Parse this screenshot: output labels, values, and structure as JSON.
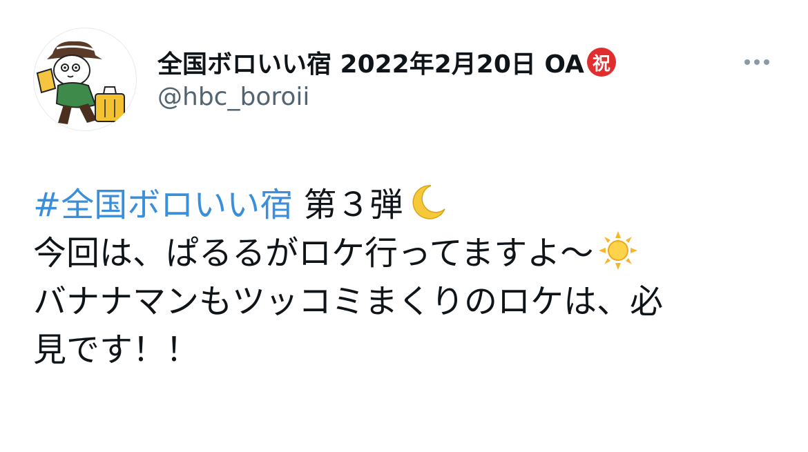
{
  "author": {
    "display_name": "全国ボロいい宿 2022年2月20日 OA",
    "badge": "祝",
    "handle": "@hbc_boroii"
  },
  "more_icon": "more-horizontal-icon",
  "tweet": {
    "hashtag": "#全国ボロいい宿",
    "line1_rest": " 第３弾",
    "line2": "今回は、ぱるるがロケ行ってますよ～",
    "line3": "バナナマンもツッコミまくりのロケは、必",
    "line4": "見です！！",
    "emojis": [
      "crescent-moon-icon",
      "sun-icon"
    ]
  },
  "colors": {
    "hashtag": "#3a8fdc",
    "handle": "#536471",
    "badge": "#e02d2d",
    "text": "#0f1419"
  }
}
